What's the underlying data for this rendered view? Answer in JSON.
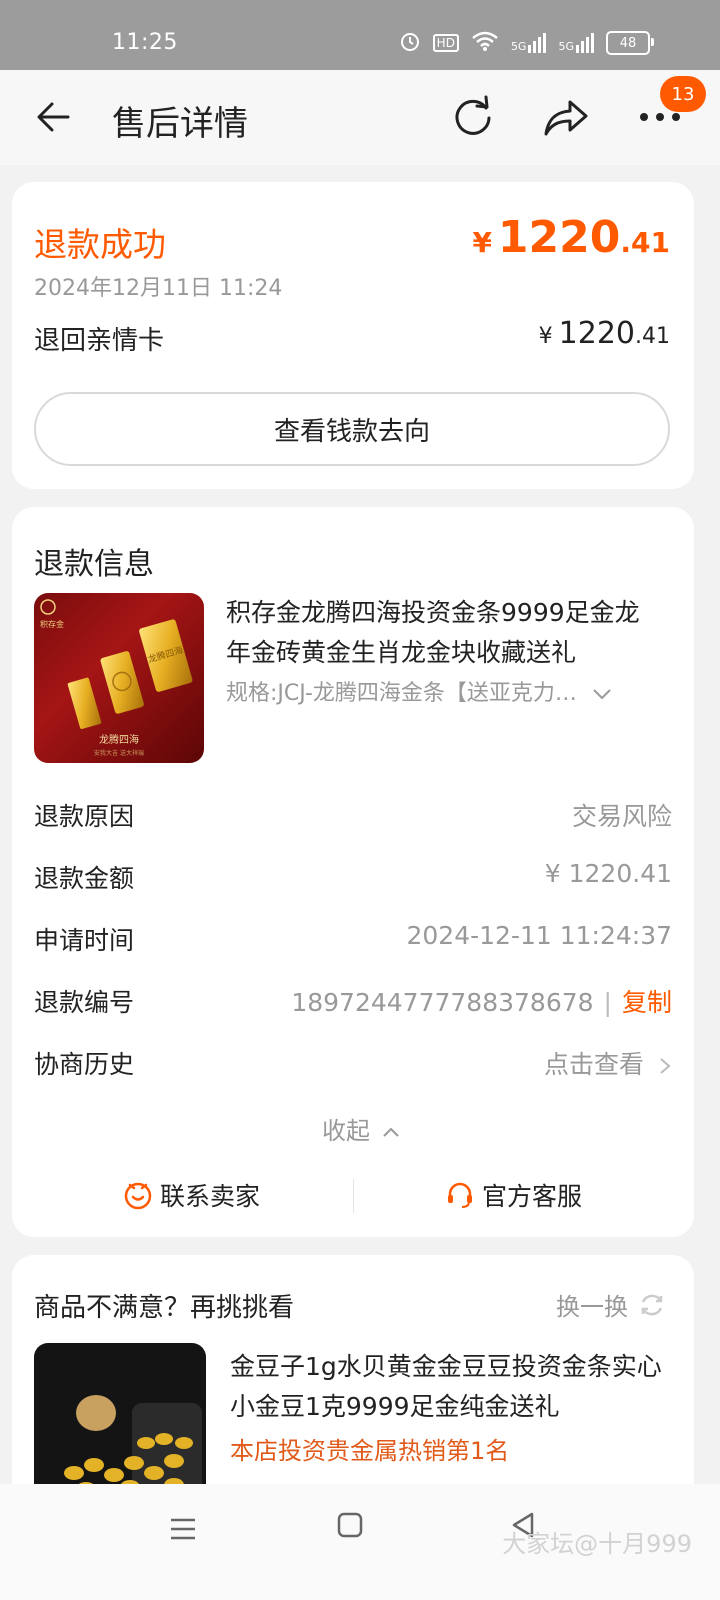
{
  "status_bar": {
    "time": "11:25",
    "hd_label": "HD",
    "signal1_label": "5G",
    "signal2_label": "5G",
    "battery": "48"
  },
  "header": {
    "title": "售后详情",
    "badge_count": "13"
  },
  "refund_summary": {
    "status": "退款成功",
    "currency": "¥",
    "amount_int": "1220",
    "amount_dec": ".41",
    "date": "2024年12月11日 11:24",
    "destination_label": "退回亲情卡",
    "destination_currency": "¥",
    "destination_amount_int": "1220",
    "destination_amount_dec": ".41",
    "trace_button": "查看钱款去向"
  },
  "refund_info": {
    "section_title": "退款信息",
    "product_title": "积存金龙腾四海投资金条9999足金龙年金砖黄金生肖龙金块收藏送礼",
    "product_spec": "规格:JCJ-龙腾四海金条【送亚克力…",
    "image_text": {
      "brand": "积存金",
      "bar_text": "龙腾四海",
      "bottom_title": "龙腾四海",
      "bottom_sub": "安我大吉 送大祥瑞"
    },
    "rows": [
      {
        "label": "退款原因",
        "value": "交易风险"
      },
      {
        "label": "退款金额",
        "value": "¥ 1220.41"
      },
      {
        "label": "申请时间",
        "value": "2024-12-11 11:24:37"
      },
      {
        "label": "退款编号",
        "value": "1897244777788378678"
      },
      {
        "label": "协商历史",
        "value": "点击查看"
      }
    ],
    "copy_separator": "|",
    "copy_label": "复制",
    "collapse_label": "收起",
    "contact_seller": "联系卖家",
    "official_service": "官方客服"
  },
  "recommendation": {
    "title": "商品不满意？再挑挑看",
    "refresh_label": "换一换",
    "item_title": "金豆子1g水贝黄金金豆豆投资金条实心小金豆1克9999足金纯金送礼",
    "item_tag": "本店投资贵金属热销第1名"
  },
  "nav": {
    "watermark": "大家坛@十月999"
  },
  "colors": {
    "accent": "#ff5a00",
    "badge": "#ff5a00",
    "muted": "#999999"
  }
}
